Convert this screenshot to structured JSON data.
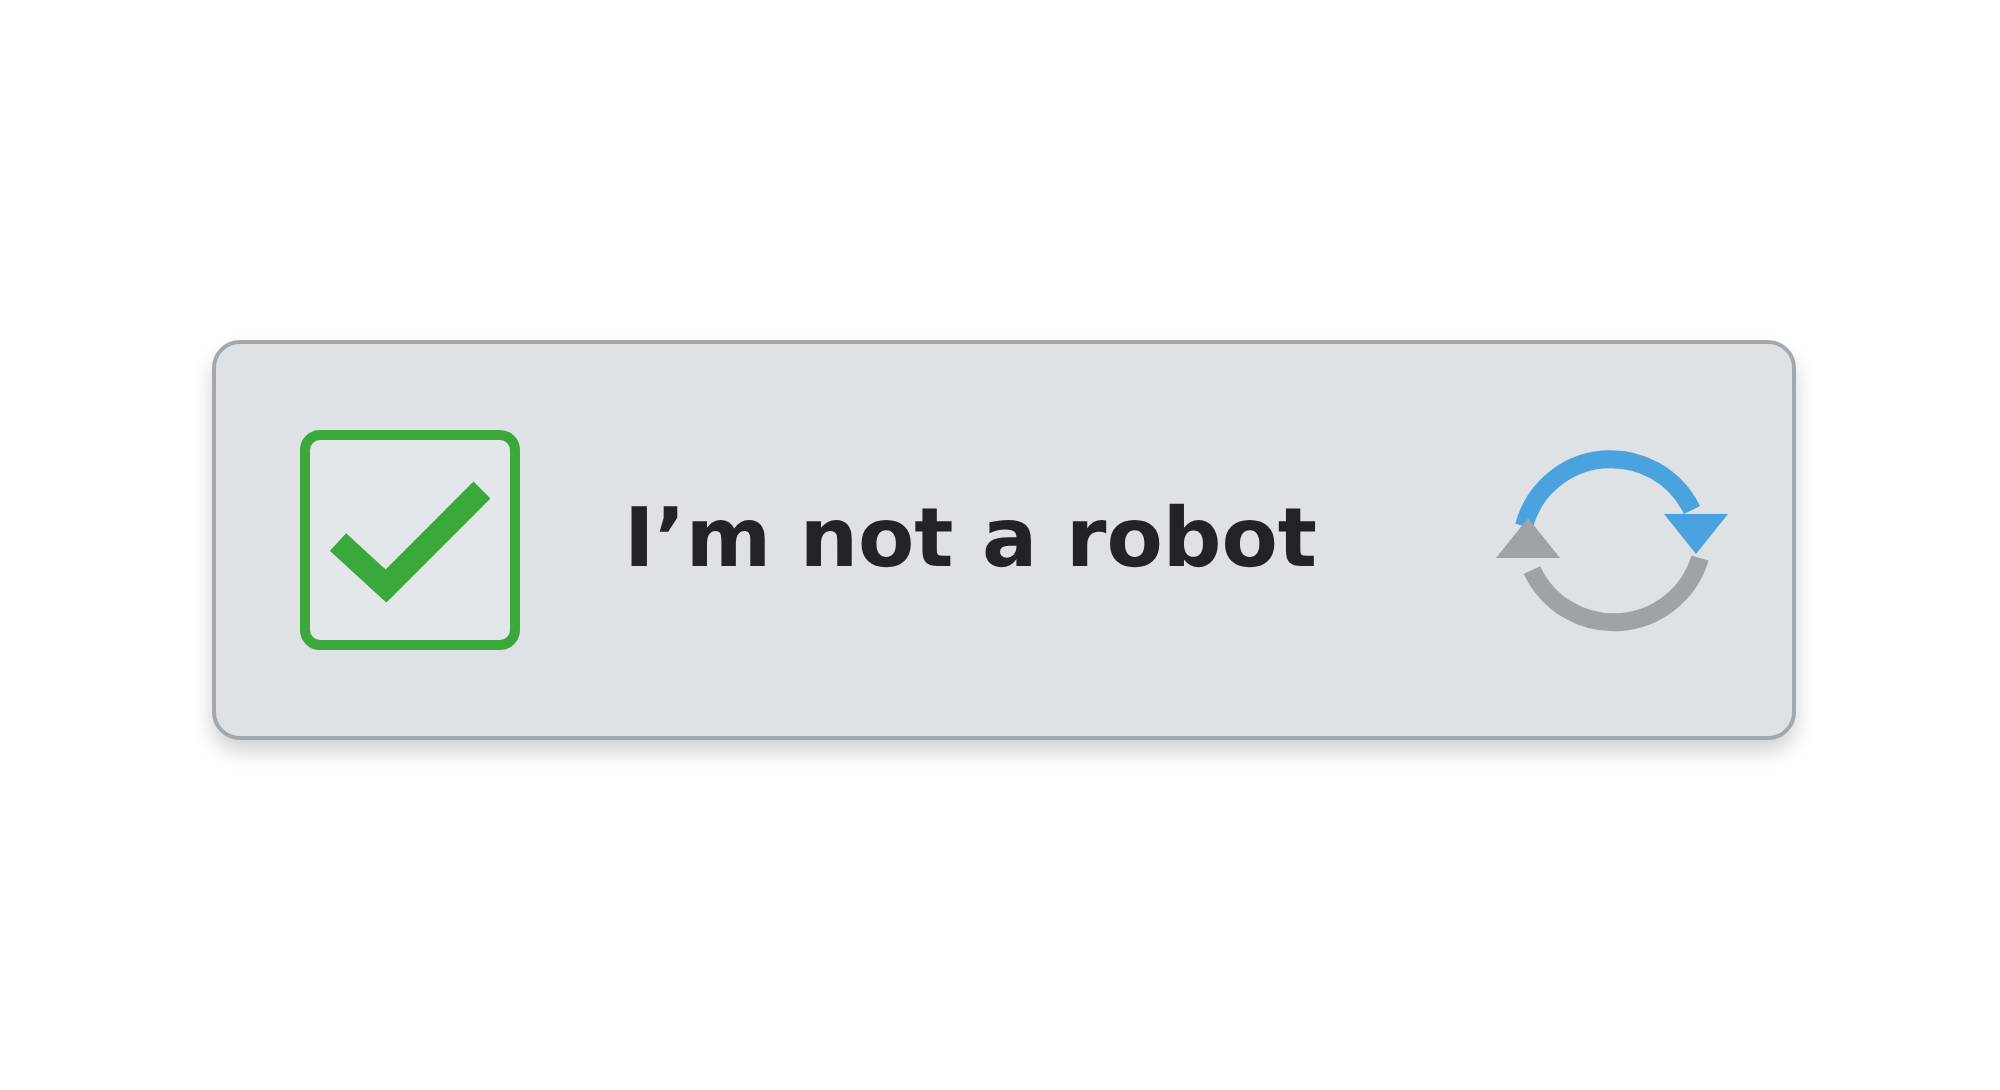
{
  "checkbox": {
    "checked": true
  },
  "label": "I’m not a robot"
}
